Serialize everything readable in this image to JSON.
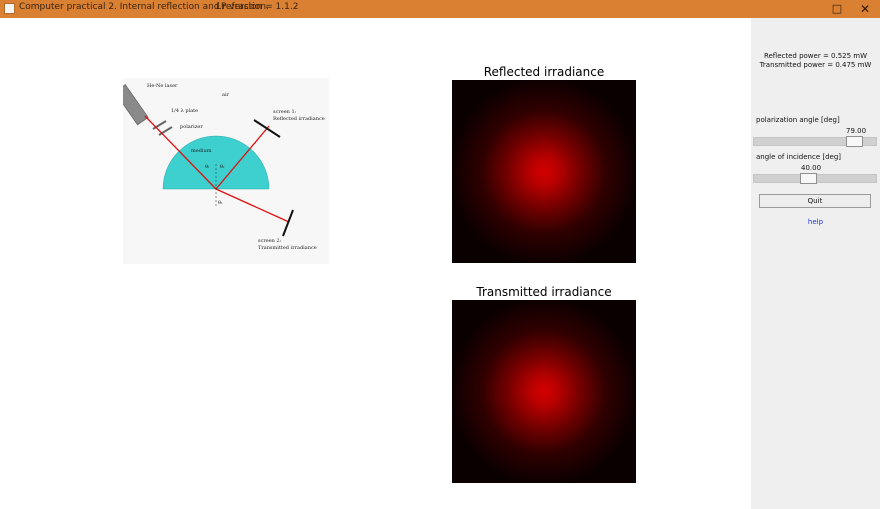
{
  "titlebar": {
    "title": "Computer practical 2. Internal reflection and refraction.",
    "version": "LP version = 1.1.2",
    "maximize_glyph": "□",
    "close_glyph": "✕",
    "app_icon": "java-icon"
  },
  "side_panel": {
    "reflected_power": "Reflected power = 0.525 mW",
    "transmitted_power": "Transmitted power = 0.475 mW",
    "polarization": {
      "label": "polarization angle [deg]",
      "value": "79.00",
      "fraction": 0.88
    },
    "incidence": {
      "label": "angle of incidence [deg]",
      "value": "40.00",
      "fraction": 0.44
    },
    "quit_label": "Quit",
    "help_label": "help"
  },
  "diagram": {
    "laser_label": "He-Ne laser",
    "air_label": "air",
    "plate_label": "1/4 λ plate",
    "polarizer_label": "polarizer",
    "medium_label": "medium",
    "screen1_line1": "screen 1:",
    "screen1_line2": "Reflected irradiance",
    "screen2_line1": "screen 2:",
    "screen2_line2": "Transmitted irradiance",
    "theta_i": "θᵢ",
    "theta_r": "θᵣ",
    "theta_t": "θₜ",
    "medium_color": "#3ecfcf",
    "beam_color": "#e01010"
  },
  "reflected": {
    "title": "Reflected irradiance"
  },
  "transmitted": {
    "title": "Transmitted irradiance"
  },
  "colors": {
    "titlebar": "#d98032",
    "panel": "#efefef",
    "spot_core": "#d40000",
    "spot_background": "#0a0000"
  }
}
